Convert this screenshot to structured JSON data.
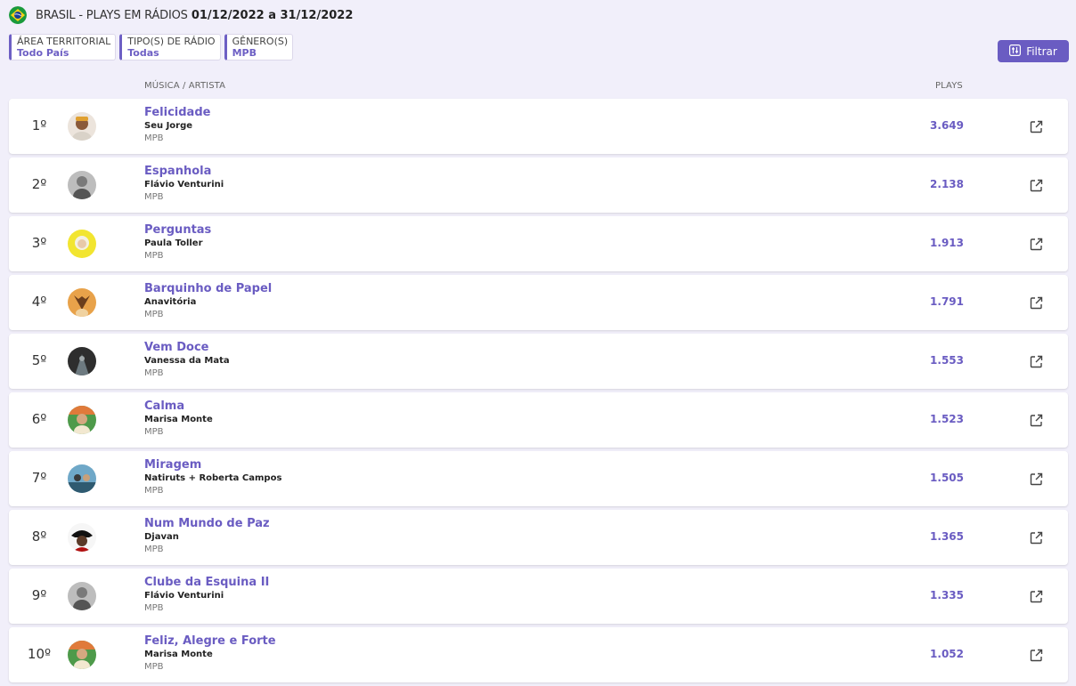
{
  "header": {
    "title_prefix": "BRASIL - PLAYS EM RÁDIOS",
    "date_range": "01/12/2022 a 31/12/2022",
    "flag_icon": "brazil-flag-icon"
  },
  "filters": [
    {
      "label": "ÁREA TERRITORIAL",
      "value": "Todo País"
    },
    {
      "label": "TIPO(S) DE RÁDIO",
      "value": "Todas"
    },
    {
      "label": "GÊNERO(S)",
      "value": "MPB"
    }
  ],
  "filter_button": {
    "label": "Filtrar",
    "icon": "sliders-icon"
  },
  "columns": {
    "music_artist": "MÚSICA / ARTISTA",
    "plays": "PLAYS"
  },
  "accent_color": "#6a5cc2",
  "rows": [
    {
      "rank": "1º",
      "song": "Felicidade",
      "artist": "Seu Jorge",
      "genre": "MPB",
      "plays": "3.649"
    },
    {
      "rank": "2º",
      "song": "Espanhola",
      "artist": "Flávio Venturini",
      "genre": "MPB",
      "plays": "2.138"
    },
    {
      "rank": "3º",
      "song": "Perguntas",
      "artist": "Paula Toller",
      "genre": "MPB",
      "plays": "1.913"
    },
    {
      "rank": "4º",
      "song": "Barquinho de Papel",
      "artist": "Anavitória",
      "genre": "MPB",
      "plays": "1.791"
    },
    {
      "rank": "5º",
      "song": "Vem Doce",
      "artist": "Vanessa da Mata",
      "genre": "MPB",
      "plays": "1.553"
    },
    {
      "rank": "6º",
      "song": "Calma",
      "artist": "Marisa Monte",
      "genre": "MPB",
      "plays": "1.523"
    },
    {
      "rank": "7º",
      "song": "Miragem",
      "artist": "Natiruts + Roberta Campos",
      "genre": "MPB",
      "plays": "1.505"
    },
    {
      "rank": "8º",
      "song": "Num Mundo de Paz",
      "artist": "Djavan",
      "genre": "MPB",
      "plays": "1.365"
    },
    {
      "rank": "9º",
      "song": "Clube da Esquina II",
      "artist": "Flávio Venturini",
      "genre": "MPB",
      "plays": "1.335"
    },
    {
      "rank": "10º",
      "song": "Feliz, Alegre e Forte",
      "artist": "Marisa Monte",
      "genre": "MPB",
      "plays": "1.052"
    }
  ]
}
